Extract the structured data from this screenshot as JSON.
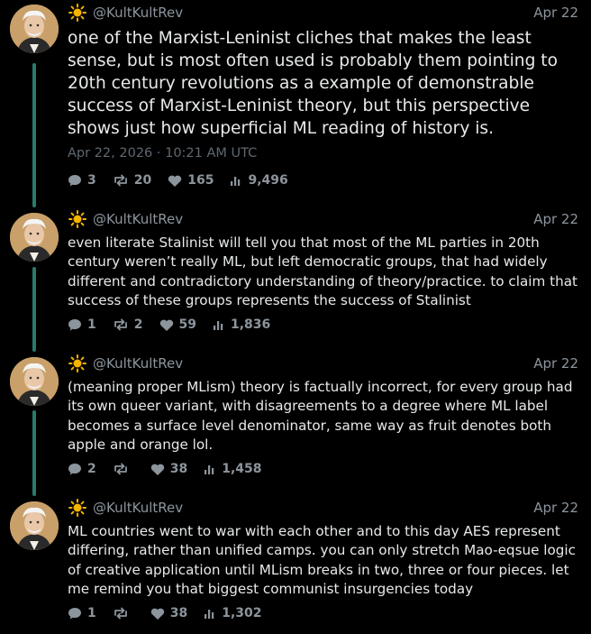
{
  "posts": [
    {
      "handle": "@KultKultRev",
      "date": "Apr 22",
      "text": "one of the Marxist-Leninist cliches that makes the least sense, but is most often used is probably them pointing to 20th century revolutions as a example of demonstrable success of Marxist-Leninist theory, but this perspective shows just how superficial ML reading of history is.",
      "timestamp": "Apr 22, 2026 · 10:21 AM UTC",
      "stats": {
        "replies": "3",
        "reposts": "20",
        "likes": "165",
        "views": "9,496"
      }
    },
    {
      "handle": "@KultKultRev",
      "date": "Apr 22",
      "text": "even literate Stalinist will tell you that most of the ML parties in 20th century weren’t really ML, but left democratic groups, that had widely different and contradictory understanding of theory/practice. to claim that success of these groups represents the success of Stalinist",
      "stats": {
        "replies": "1",
        "reposts": "2",
        "likes": "59",
        "views": "1,836"
      }
    },
    {
      "handle": "@KultKultRev",
      "date": "Apr 22",
      "text": "(meaning proper MLism) theory is factually incorrect, for every group had its own queer variant, with disagreements to a degree where ML label becomes a surface level denominator, same way as fruit denotes both apple and orange lol.",
      "stats": {
        "replies": "2",
        "reposts": "",
        "likes": "38",
        "views": "1,458"
      }
    },
    {
      "handle": "@KultKultRev",
      "date": "Apr 22",
      "text": "ML countries went to war with each other and to this day AES represent differing, rather than unified camps. you can only stretch Mao-eqsue logic of creative application until MLism breaks in two, three or four pieces. let me remind you that biggest communist insurgencies today",
      "stats": {
        "replies": "1",
        "reposts": "",
        "likes": "38",
        "views": "1,302"
      }
    }
  ],
  "colors": {
    "background": "#000000",
    "text": "#e7e9ea",
    "muted": "#8c949c",
    "thread_line": "#2a7a6a",
    "sun": "#f5b400"
  },
  "icons": [
    "sun-icon",
    "reply-icon",
    "repost-icon",
    "like-icon",
    "views-icon"
  ]
}
